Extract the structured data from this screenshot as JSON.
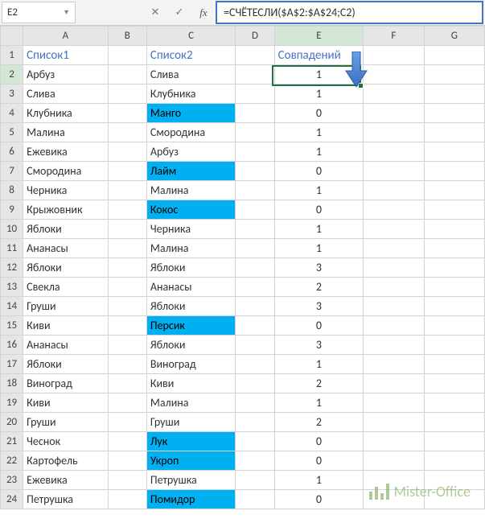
{
  "name_box": "E2",
  "formula": "=СЧЁТЕСЛИ($A$2:$A$24;C2)",
  "buttons": {
    "cancel": "✕",
    "confirm": "✓",
    "fx": "fx"
  },
  "columns": [
    "A",
    "B",
    "C",
    "D",
    "E",
    "F",
    "G"
  ],
  "selected_col": "E",
  "selected_row": 2,
  "headers": {
    "A": "Список1",
    "C": "Список2",
    "E": "Совпадений"
  },
  "rows": [
    {
      "n": 2,
      "a": "Арбуз",
      "c": "Слива",
      "e": 1,
      "hl": false
    },
    {
      "n": 3,
      "a": "Слива",
      "c": "Клубника",
      "e": 1,
      "hl": false
    },
    {
      "n": 4,
      "a": "Клубника",
      "c": "Манго",
      "e": 0,
      "hl": true
    },
    {
      "n": 5,
      "a": "Малина",
      "c": "Смородина",
      "e": 1,
      "hl": false
    },
    {
      "n": 6,
      "a": "Ежевика",
      "c": "Арбуз",
      "e": 1,
      "hl": false
    },
    {
      "n": 7,
      "a": "Смородина",
      "c": "Лайм",
      "e": 0,
      "hl": true
    },
    {
      "n": 8,
      "a": "Черника",
      "c": "Малина",
      "e": 1,
      "hl": false
    },
    {
      "n": 9,
      "a": "Крыжовник",
      "c": "Кокос",
      "e": 0,
      "hl": true
    },
    {
      "n": 10,
      "a": "Яблоки",
      "c": "Черника",
      "e": 1,
      "hl": false
    },
    {
      "n": 11,
      "a": "Ананасы",
      "c": "Малина",
      "e": 1,
      "hl": false
    },
    {
      "n": 12,
      "a": "Яблоки",
      "c": "Яблоки",
      "e": 3,
      "hl": false
    },
    {
      "n": 13,
      "a": "Свекла",
      "c": "Ананасы",
      "e": 2,
      "hl": false
    },
    {
      "n": 14,
      "a": "Груши",
      "c": "Яблоки",
      "e": 3,
      "hl": false
    },
    {
      "n": 15,
      "a": "Киви",
      "c": "Персик",
      "e": 0,
      "hl": true
    },
    {
      "n": 16,
      "a": "Ананасы",
      "c": "Яблоки",
      "e": 3,
      "hl": false
    },
    {
      "n": 17,
      "a": "Яблоки",
      "c": "Виноград",
      "e": 1,
      "hl": false
    },
    {
      "n": 18,
      "a": "Виноград",
      "c": "Киви",
      "e": 2,
      "hl": false
    },
    {
      "n": 19,
      "a": "Киви",
      "c": "Малина",
      "e": 1,
      "hl": false
    },
    {
      "n": 20,
      "a": "Груши",
      "c": "Груши",
      "e": 2,
      "hl": false
    },
    {
      "n": 21,
      "a": "Чеснок",
      "c": "Лук",
      "e": 0,
      "hl": true
    },
    {
      "n": 22,
      "a": "Картофель",
      "c": "Укроп",
      "e": 0,
      "hl": true
    },
    {
      "n": 23,
      "a": "Ежевика",
      "c": "Петрушка",
      "e": 1,
      "hl": false
    },
    {
      "n": 24,
      "a": "Петрушка",
      "c": "Помидор",
      "e": 0,
      "hl": true
    }
  ],
  "watermark": "Mister-Office"
}
